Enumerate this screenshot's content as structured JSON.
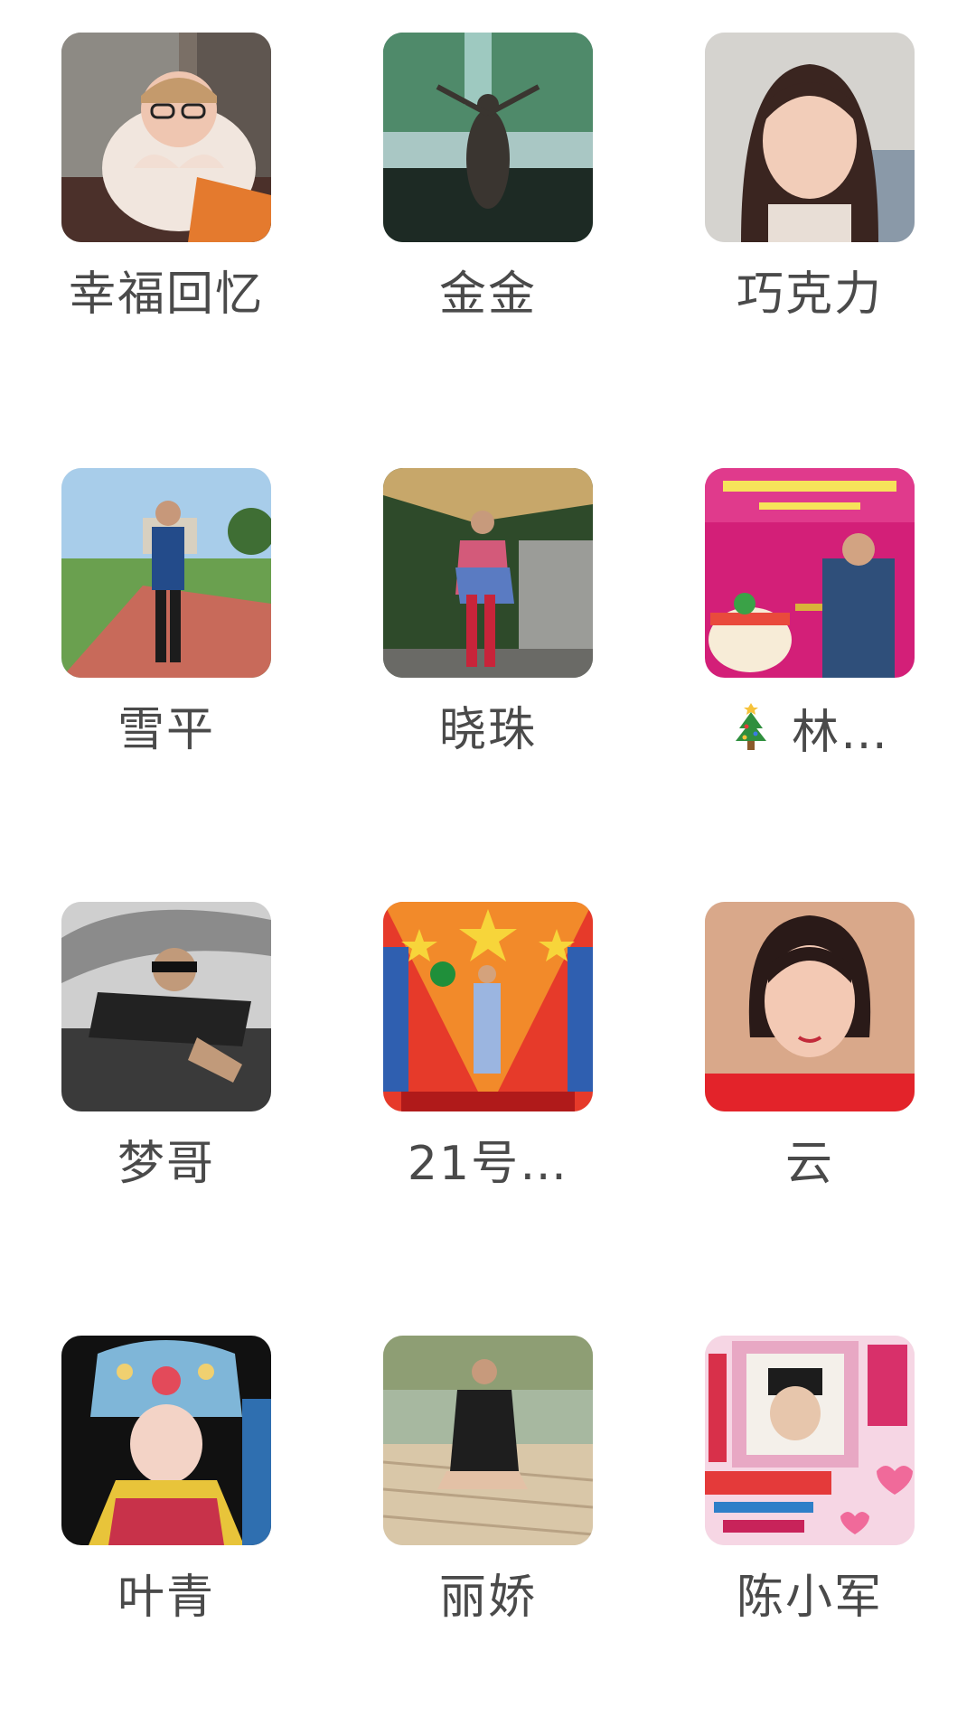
{
  "contacts": [
    {
      "name": "幸福回忆"
    },
    {
      "name": "金金"
    },
    {
      "name": "巧克力"
    },
    {
      "name": "雪平"
    },
    {
      "name": "晓珠"
    },
    {
      "name": "林…",
      "prefix_icon": "christmas-tree-icon"
    },
    {
      "name": "梦哥"
    },
    {
      "name": "21号…"
    },
    {
      "name": "云"
    },
    {
      "name": "叶青"
    },
    {
      "name": "丽娇"
    },
    {
      "name": "陈小军"
    }
  ],
  "colors": {
    "background": "#ffffff",
    "name_text": "#4a4a4a"
  }
}
